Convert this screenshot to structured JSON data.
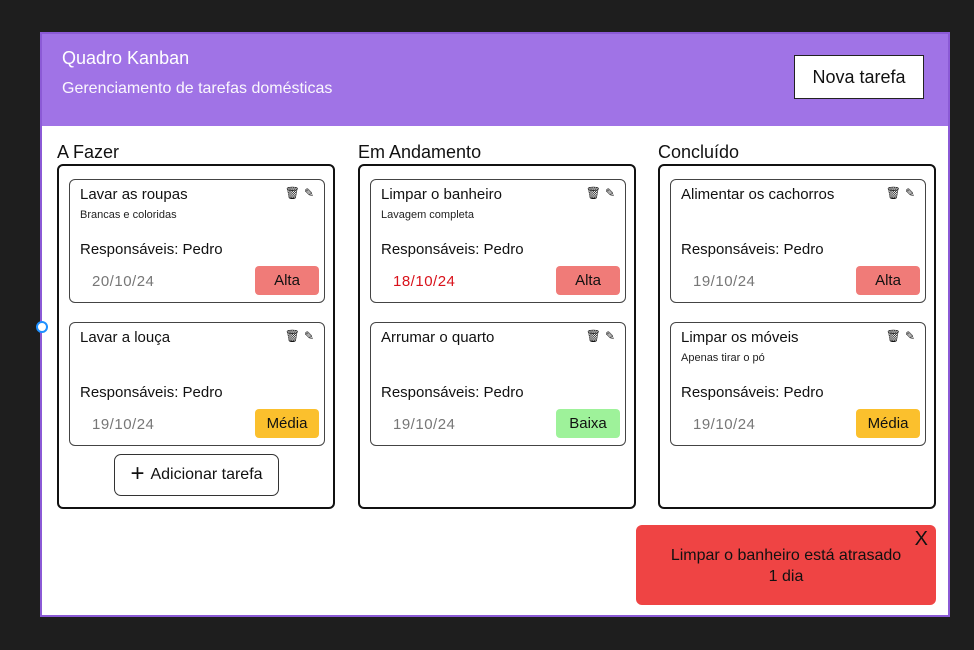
{
  "header": {
    "title": "Quadro Kanban",
    "subtitle": "Gerenciamento de tarefas domésticas",
    "new_task_label": "Nova tarefa"
  },
  "columns": [
    {
      "title": "A Fazer",
      "add_label": "Adicionar tarefa",
      "cards": [
        {
          "title": "Lavar as roupas",
          "description": "Brancas e coloridas",
          "responsible": "Responsáveis: Pedro",
          "date": "20/10/24",
          "priority": "Alta"
        },
        {
          "title": "Lavar a louça",
          "description": "",
          "responsible": "Responsáveis: Pedro",
          "date": "19/10/24",
          "priority": "Média"
        }
      ]
    },
    {
      "title": "Em Andamento",
      "cards": [
        {
          "title": "Limpar o banheiro",
          "description": "Lavagem completa",
          "responsible": "Responsáveis: Pedro",
          "date": "18/10/24",
          "priority": "Alta"
        },
        {
          "title": "Arrumar o quarto",
          "description": "",
          "responsible": "Responsáveis: Pedro",
          "date": "19/10/24",
          "priority": "Baixa"
        }
      ]
    },
    {
      "title": "Concluído",
      "cards": [
        {
          "title": "Alimentar os cachorros",
          "description": "",
          "responsible": "Responsáveis: Pedro",
          "date": "19/10/24",
          "priority": "Alta"
        },
        {
          "title": "Limpar os móveis",
          "description": "Apenas tirar o pó",
          "responsible": "Responsáveis: Pedro",
          "date": "19/10/24",
          "priority": "Média"
        }
      ]
    }
  ],
  "toast": {
    "message": "Limpar o banheiro está atrasado 1 dia",
    "close_label": "X"
  },
  "icons": {
    "delete": "trash-icon",
    "edit": "pencil-icon",
    "add": "plus-icon"
  },
  "colors": {
    "header": "#a073e6",
    "priority_alta": "#f07b78",
    "priority_media": "#fbc02d",
    "priority_baixa": "#9ef29a",
    "overdue_date": "#d9121b",
    "toast": "#ef4444"
  }
}
